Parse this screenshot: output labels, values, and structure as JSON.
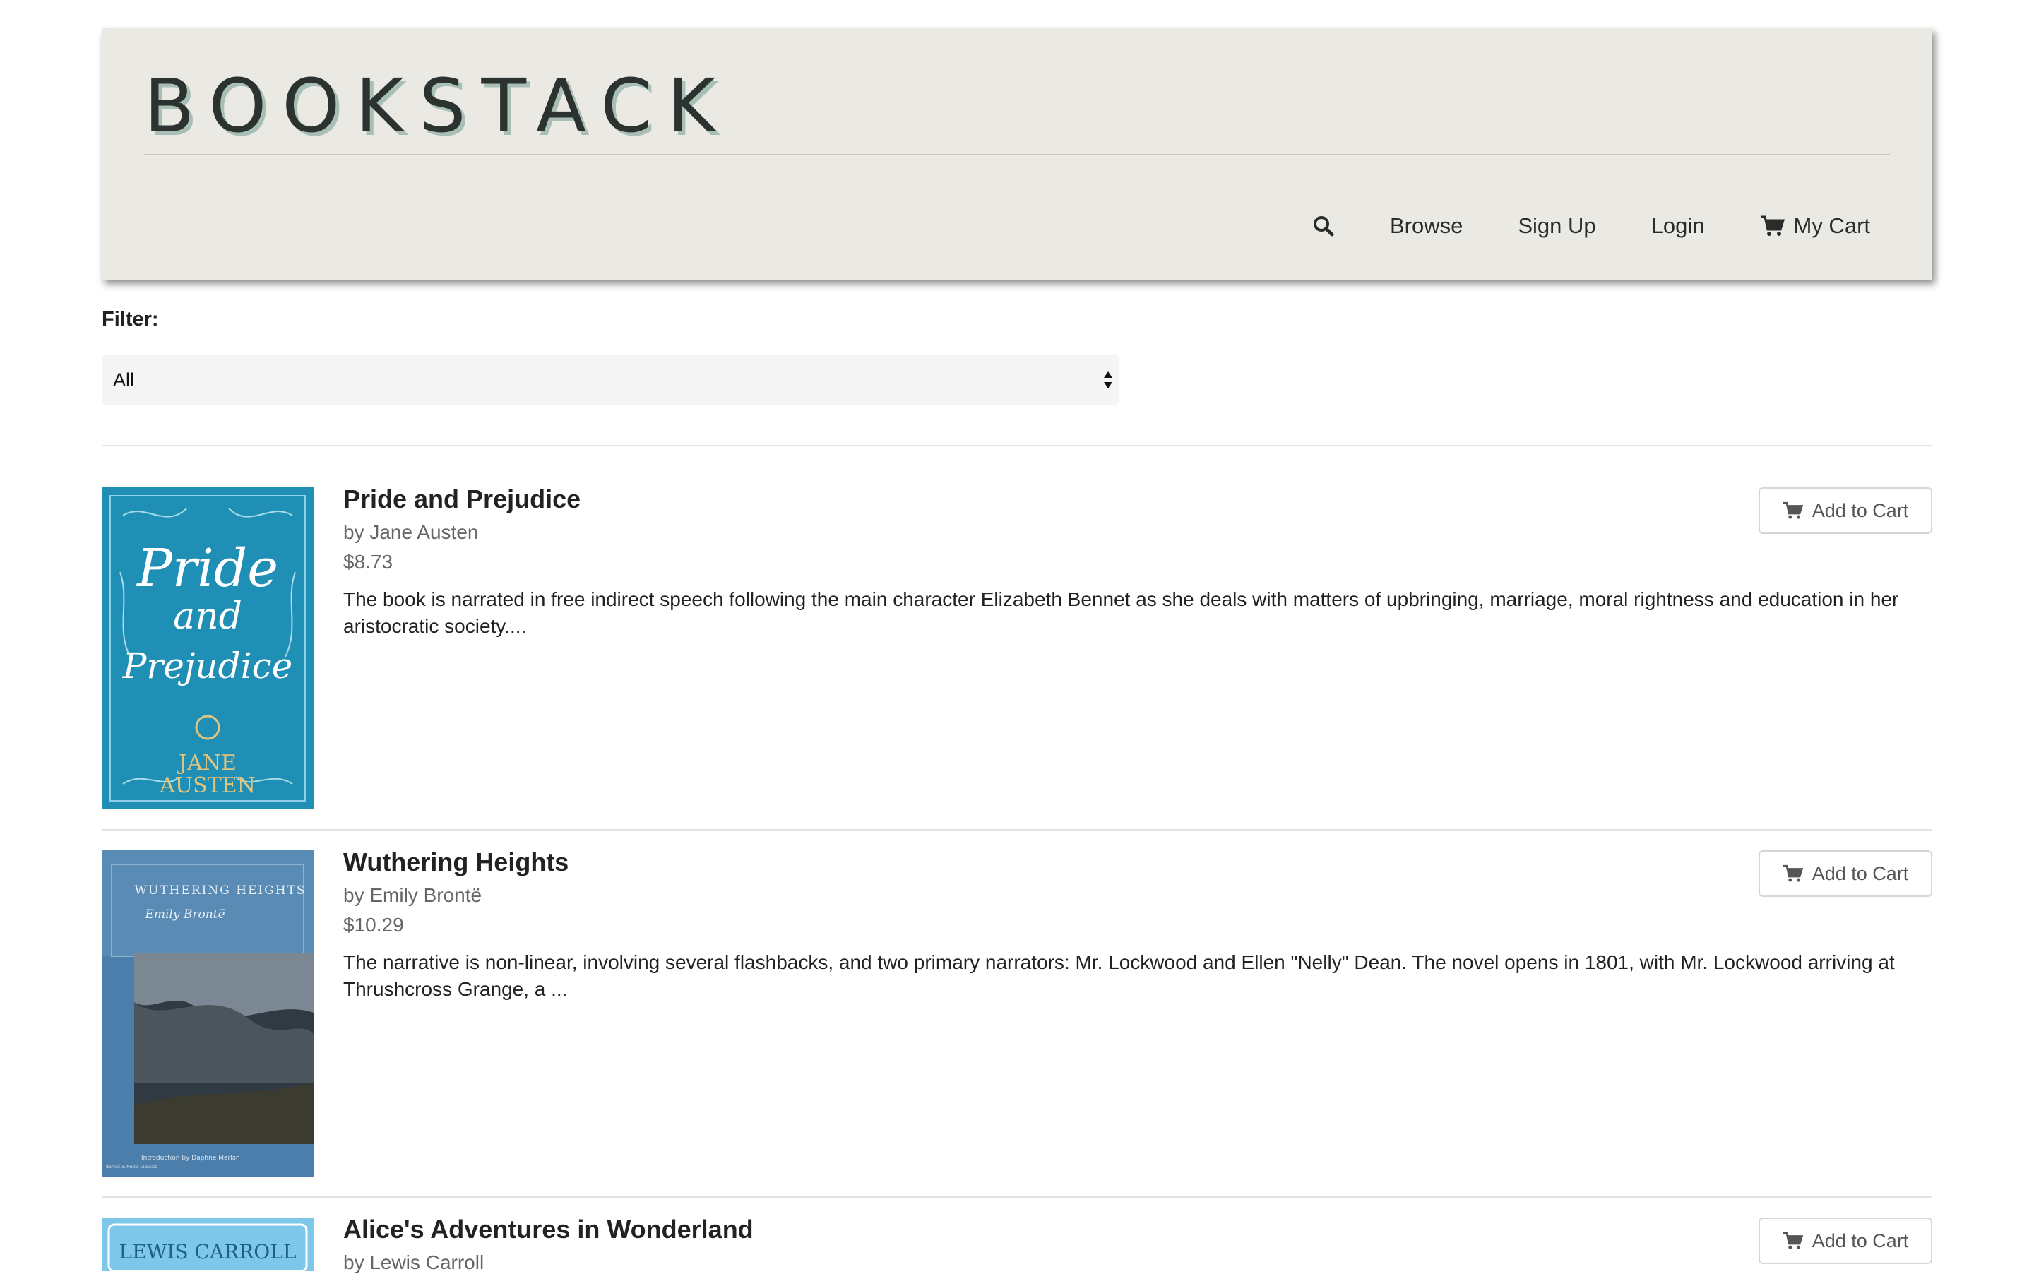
{
  "header": {
    "logo": "BOOKSTACK",
    "nav": {
      "search_icon": "search-icon",
      "browse": "Browse",
      "signup": "Sign Up",
      "login": "Login",
      "cart_icon": "cart-icon",
      "cart": "My Cart"
    }
  },
  "filter": {
    "label": "Filter:",
    "selected": "All"
  },
  "books": [
    {
      "title": "Pride and Prejudice",
      "author": "by Jane Austen",
      "price": "$8.73",
      "description": "The book is narrated in free indirect speech following the main character Elizabeth Bennet as she deals with matters of upbringing, marriage, moral rightness and education in her aristocratic society....",
      "button": "Add to Cart",
      "cover": {
        "line1": "Pride",
        "line2": "and",
        "line3": "Prejudice",
        "author_top": "JANE",
        "author_bottom": "AUSTEN",
        "color": "#1f8fb5"
      }
    },
    {
      "title": "Wuthering Heights",
      "author": "by Emily Brontë",
      "price": "$10.29",
      "description": "The narrative is non-linear, involving several flashbacks, and two primary narrators: Mr. Lockwood and Ellen \"Nelly\" Dean. The novel opens in 1801, with Mr. Lockwood arriving at Thrushcross Grange, a ...",
      "button": "Add to Cart",
      "cover": {
        "title": "WUTHERING HEIGHTS",
        "author": "Emily Brontë",
        "intro": "Introduction by Daphne Merkin",
        "publisher": "Barnes & Noble Classics",
        "color": "#4b7eaa"
      }
    },
    {
      "title": "Alice's Adventures in Wonderland",
      "author": "by Lewis Carroll",
      "price": "",
      "description": "",
      "button": "Add to Cart",
      "cover": {
        "author": "LEWIS CARROLL",
        "color": "#7cc7ea"
      }
    }
  ],
  "colors": {
    "header_bg": "#eae9e4",
    "logo": "#2b3230",
    "logo_shadow": "#a7bfb5",
    "muted_text": "#666666"
  }
}
